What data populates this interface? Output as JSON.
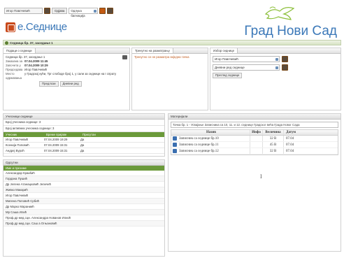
{
  "toolbar": {
    "user": "Игор Павлчевић",
    "logout": "Одјава",
    "select": "Одлука багниција"
  },
  "app_logo": "e.Седнице",
  "brand": "Град Нови Сад",
  "session": {
    "title": "Седница бр. 37, заседање 1"
  },
  "details": {
    "tab": "Подаци о седници",
    "header": "Седница бр. 37, заседање 1",
    "rows": [
      {
        "k": "Заказана за",
        "v": "07.04.2009 11:45"
      },
      {
        "k": "Започета у",
        "v": "07.04.2009 10:29"
      },
      {
        "k": "Председава",
        "v": "Игор Павлчевић"
      },
      {
        "k": "Место одржавања",
        "v": "у Градској кући, Трг слободе број 1, у сали за седнице на I спрату"
      }
    ],
    "btn_agenda": "Предлози",
    "btn_daily": "Дневни ред"
  },
  "current": {
    "tab": "Тренутно на разматрању",
    "text": "Тренутно се не разматра ниједна тачка"
  },
  "choose": {
    "tab": "Избор седнице",
    "select1": "Игор Павлчевић",
    "select2": "Дневни ред седнице",
    "btn": "Преглед седнице"
  },
  "participants": {
    "head": "Учесници седнице",
    "count_line": "Број учесника седнице: 3",
    "active_line": "Број активних учесника седнице: 3",
    "columns": [
      "Учесник",
      "Време пријаве",
      "Присутан"
    ],
    "rows": [
      [
        "Игор Павлчевић",
        "07.04.2009 19:29",
        "Да"
      ],
      [
        "Ксенија Поповић",
        "07.04.2009 15:31",
        "Да"
      ],
      [
        "Андреј Вуроћ",
        "07.04.2009 15:31",
        "Да"
      ]
    ]
  },
  "absent": {
    "head": "Одсутни",
    "subhead": "Име и презиме",
    "items": [
      "Александар Краиšић",
      "Гордана Пушић",
      "Др Јелена Атанацковић Јеличић",
      "Живко Макарић",
      "Игор Павлчевић",
      "Милена Поповић Србић",
      "Др Марко Мараниић",
      "Мр Саша Илић",
      "Проф.др мед.сци. Александра Нованов Илиоћ",
      "Проф.др мед.сци. Саш а Огњановић"
    ]
  },
  "materials": {
    "head": "Материјали",
    "doc_bar": "Тачка бр. 1 - Усвајање Записника са 10, 11. и 12. седнице Градског већа Града Новог Сада",
    "columns": [
      "Назив",
      "Инфо",
      "Величина",
      "Датум"
    ],
    "rows": [
      [
        "Записник са седнице бр.10",
        "",
        "32 B",
        "07.04"
      ],
      [
        "Записник са седнице бр.11",
        "",
        "45 B",
        "07.04"
      ],
      [
        "Записник са седнице бр.12",
        "",
        "32 B",
        "07.04"
      ]
    ]
  },
  "colors": {
    "accent_green": "#6b9a3a",
    "brand_blue": "#3b78b8",
    "logo_orange": "#c84a1c"
  }
}
